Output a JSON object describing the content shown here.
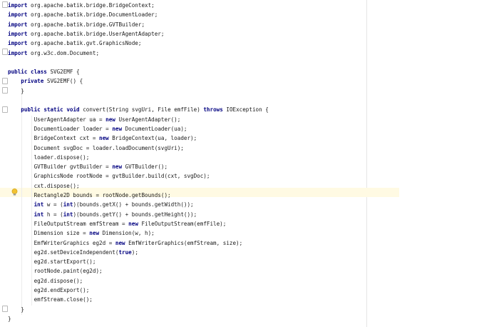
{
  "code": {
    "lines": [
      {
        "tokens": [
          {
            "t": "import",
            "k": true
          },
          {
            "t": " org.apache.batik.bridge.BridgeContext;"
          }
        ]
      },
      {
        "tokens": [
          {
            "t": "import",
            "k": true
          },
          {
            "t": " org.apache.batik.bridge.DocumentLoader;"
          }
        ]
      },
      {
        "tokens": [
          {
            "t": "import",
            "k": true
          },
          {
            "t": " org.apache.batik.bridge.GVTBuilder;"
          }
        ]
      },
      {
        "tokens": [
          {
            "t": "import",
            "k": true
          },
          {
            "t": " org.apache.batik.bridge.UserAgentAdapter;"
          }
        ]
      },
      {
        "tokens": [
          {
            "t": "import",
            "k": true
          },
          {
            "t": " org.apache.batik.gvt.GraphicsNode;"
          }
        ]
      },
      {
        "tokens": [
          {
            "t": "import",
            "k": true
          },
          {
            "t": " org.w3c.dom.Document;"
          }
        ]
      },
      {
        "tokens": []
      },
      {
        "tokens": [
          {
            "t": "public",
            "k": true
          },
          {
            "t": " "
          },
          {
            "t": "class",
            "k": true
          },
          {
            "t": " SVG2EMF {"
          }
        ]
      },
      {
        "tokens": [
          {
            "t": "    "
          },
          {
            "t": "private",
            "k": true
          },
          {
            "t": " SVG2EMF() {"
          }
        ]
      },
      {
        "tokens": [
          {
            "t": "    }"
          }
        ]
      },
      {
        "tokens": []
      },
      {
        "tokens": [
          {
            "t": "    "
          },
          {
            "t": "public",
            "k": true
          },
          {
            "t": " "
          },
          {
            "t": "static",
            "k": true
          },
          {
            "t": " "
          },
          {
            "t": "void",
            "k": true
          },
          {
            "t": " convert(String svgUri, File emfFile) "
          },
          {
            "t": "throws",
            "k": true
          },
          {
            "t": " IOException {"
          }
        ]
      },
      {
        "tokens": [
          {
            "t": "        UserAgentAdapter ua = "
          },
          {
            "t": "new",
            "k": true
          },
          {
            "t": " UserAgentAdapter();"
          }
        ]
      },
      {
        "tokens": [
          {
            "t": "        DocumentLoader loader = "
          },
          {
            "t": "new",
            "k": true
          },
          {
            "t": " DocumentLoader(ua);"
          }
        ]
      },
      {
        "tokens": [
          {
            "t": "        BridgeContext cxt = "
          },
          {
            "t": "new",
            "k": true
          },
          {
            "t": " BridgeContext(ua, loader);"
          }
        ]
      },
      {
        "tokens": [
          {
            "t": "        Document svgDoc = loader.loadDocument(svgUri);"
          }
        ]
      },
      {
        "tokens": [
          {
            "t": "        loader.dispose();"
          }
        ]
      },
      {
        "tokens": [
          {
            "t": "        GVTBuilder gvtBuilder = "
          },
          {
            "t": "new",
            "k": true
          },
          {
            "t": " GVTBuilder();"
          }
        ]
      },
      {
        "tokens": [
          {
            "t": "        GraphicsNode rootNode = gvtBuilder.build(cxt, svgDoc);"
          }
        ]
      },
      {
        "tokens": [
          {
            "t": "        cxt.dispose();"
          }
        ]
      },
      {
        "tokens": [
          {
            "t": "        Rectangle2D bounds = rootNode.getBounds();"
          }
        ]
      },
      {
        "tokens": [
          {
            "t": "        "
          },
          {
            "t": "int",
            "k": true
          },
          {
            "t": " w = ("
          },
          {
            "t": "int",
            "k": true
          },
          {
            "t": ")(bounds.getX() + bounds.getWidth());"
          }
        ]
      },
      {
        "tokens": [
          {
            "t": "        "
          },
          {
            "t": "int",
            "k": true
          },
          {
            "t": " h = ("
          },
          {
            "t": "int",
            "k": true
          },
          {
            "t": ")(bounds.getY() + bounds.getHeight());"
          }
        ]
      },
      {
        "tokens": [
          {
            "t": "        FileOutputStream emfStream = "
          },
          {
            "t": "new",
            "k": true
          },
          {
            "t": " FileOutputStream(emfFile);"
          }
        ]
      },
      {
        "tokens": [
          {
            "t": "        Dimension size = "
          },
          {
            "t": "new",
            "k": true
          },
          {
            "t": " Dimension(w, h);"
          }
        ]
      },
      {
        "tokens": [
          {
            "t": "        EmfWriterGraphics eg2d = "
          },
          {
            "t": "new",
            "k": true
          },
          {
            "t": " EmfWriterGraphics(emfStream, size);"
          }
        ]
      },
      {
        "tokens": [
          {
            "t": "        eg2d.setDeviceIndependent("
          },
          {
            "t": "true",
            "k": true
          },
          {
            "t": ");"
          }
        ]
      },
      {
        "tokens": [
          {
            "t": "        eg2d.startExport();"
          }
        ]
      },
      {
        "tokens": [
          {
            "t": "        rootNode.paint(eg2d);"
          }
        ]
      },
      {
        "tokens": [
          {
            "t": "        eg2d.dispose();"
          }
        ]
      },
      {
        "tokens": [
          {
            "t": "        eg2d.endExport();"
          }
        ]
      },
      {
        "tokens": [
          {
            "t": "        emfStream.close();"
          }
        ]
      },
      {
        "tokens": [
          {
            "t": "    }"
          }
        ]
      },
      {
        "tokens": [
          {
            "t": "}"
          }
        ]
      }
    ],
    "highlighted_line": 20,
    "colors": {
      "keyword": "#000080",
      "text": "#1a1a1a",
      "current_line": "#fffae3",
      "bulb": "#f2c230"
    },
    "icons": {
      "intention": "lightbulb-icon",
      "fold": "fold-marker-icon"
    }
  }
}
